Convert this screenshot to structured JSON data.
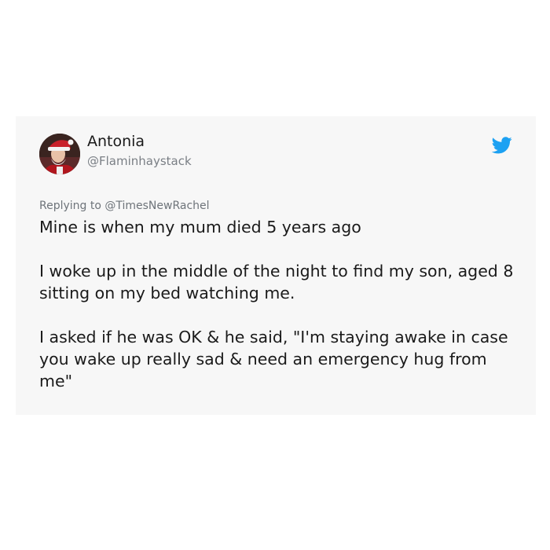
{
  "tweet": {
    "author": {
      "display_name": "Antonia",
      "handle": "@Flaminhaystack",
      "avatar": "santa-hat-selfie-photo"
    },
    "platform_icon": "twitter-bird-icon",
    "brand_color": "#1DA1F2",
    "replying_to": "Replying to @TimesNewRachel",
    "paragraphs": [
      "Mine is when my mum died 5 years ago",
      "I woke up in the middle of the night to find my son, aged 8 sitting on my bed watching me.",
      "I asked if he was OK & he said, \"I'm staying awake in case you wake up really sad & need an emergency hug from me\""
    ]
  }
}
